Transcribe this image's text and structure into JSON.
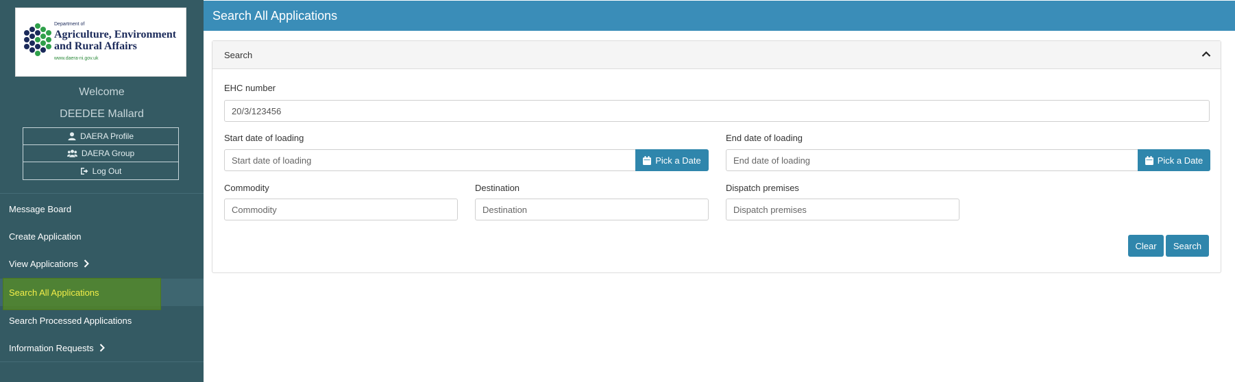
{
  "sidebar": {
    "logo": {
      "small_text": "Department of",
      "line1": "Agriculture, Environment",
      "line2": "and Rural Affairs",
      "url": "www.daera-ni.gov.uk"
    },
    "welcome": "Welcome",
    "user_name": "DEEDEE Mallard",
    "profile_links": [
      {
        "label": "DAERA Profile",
        "icon": "user-icon"
      },
      {
        "label": "DAERA Group",
        "icon": "users-icon"
      },
      {
        "label": "Log Out",
        "icon": "sign-out-icon"
      }
    ],
    "nav": [
      {
        "label": "Message Board"
      },
      {
        "label": "Create Application"
      },
      {
        "label": "View Applications"
      },
      {
        "label": "Search All Applications"
      },
      {
        "label": "Search Processed Applications"
      },
      {
        "label": "Information Requests"
      }
    ]
  },
  "header": {
    "title": "Search All Applications"
  },
  "search_panel": {
    "title": "Search",
    "ehc": {
      "label": "EHC number",
      "value": "20/3/123456"
    },
    "start_date": {
      "label": "Start date of loading",
      "placeholder": "Start date of loading",
      "button": "Pick a Date"
    },
    "end_date": {
      "label": "End date of loading",
      "placeholder": "End date of loading",
      "button": "Pick a Date"
    },
    "commodity": {
      "label": "Commodity",
      "placeholder": "Commodity"
    },
    "destination": {
      "label": "Destination",
      "placeholder": "Destination"
    },
    "dispatch": {
      "label": "Dispatch premises",
      "placeholder": "Dispatch premises"
    },
    "clear_label": "Clear",
    "search_label": "Search"
  },
  "colors": {
    "sidebar_bg": "#345a63",
    "header_bg": "#3a8db8",
    "button_bg": "#2f86ac",
    "highlight": "#568c20",
    "active_text": "#f3ee4a"
  }
}
